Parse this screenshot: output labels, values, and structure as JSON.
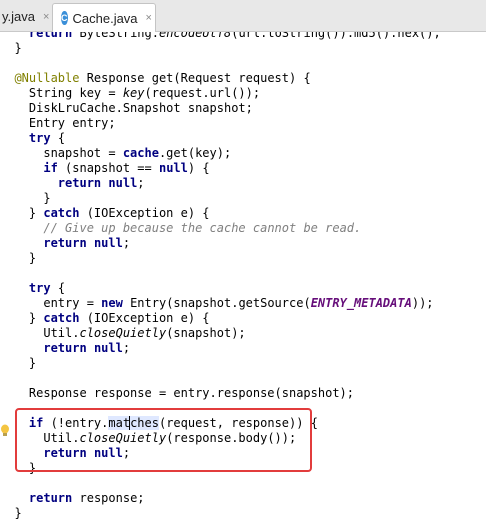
{
  "tabs": [
    {
      "label": "y.java",
      "active": false
    },
    {
      "label": "Cache.java",
      "active": true,
      "icon_letter": "C"
    }
  ],
  "icons": {
    "close": "×",
    "file": "java-class-icon",
    "bulb": "lightbulb-icon"
  },
  "code": {
    "lines": [
      "    return ByteString.encodeUtf8(url.toString()).md5().hex();",
      "  }",
      "",
      "  @Nullable Response get(Request request) {",
      "    String key = key(request.url());",
      "    DiskLruCache.Snapshot snapshot;",
      "    Entry entry;",
      "    try {",
      "      snapshot = cache.get(key);",
      "      if (snapshot == null) {",
      "        return null;",
      "      }",
      "    } catch (IOException e) {",
      "      // Give up because the cache cannot be read.",
      "      return null;",
      "    }",
      "",
      "    try {",
      "      entry = new Entry(snapshot.getSource(ENTRY_METADATA));",
      "    } catch (IOException e) {",
      "      Util.closeQuietly(snapshot);",
      "      return null;",
      "    }",
      "",
      "    Response response = entry.response(snapshot);",
      "",
      "    if (!entry.matches(request, response)) {",
      "      Util.closeQuietly(response.body());",
      "      return null;",
      "    }",
      "",
      "    return response;",
      "  }"
    ]
  },
  "colors": {
    "keyword": "#000080",
    "annotation": "#808000",
    "comment": "#808080",
    "constant": "#660e7a",
    "highlight_box": "#e23c3c"
  }
}
